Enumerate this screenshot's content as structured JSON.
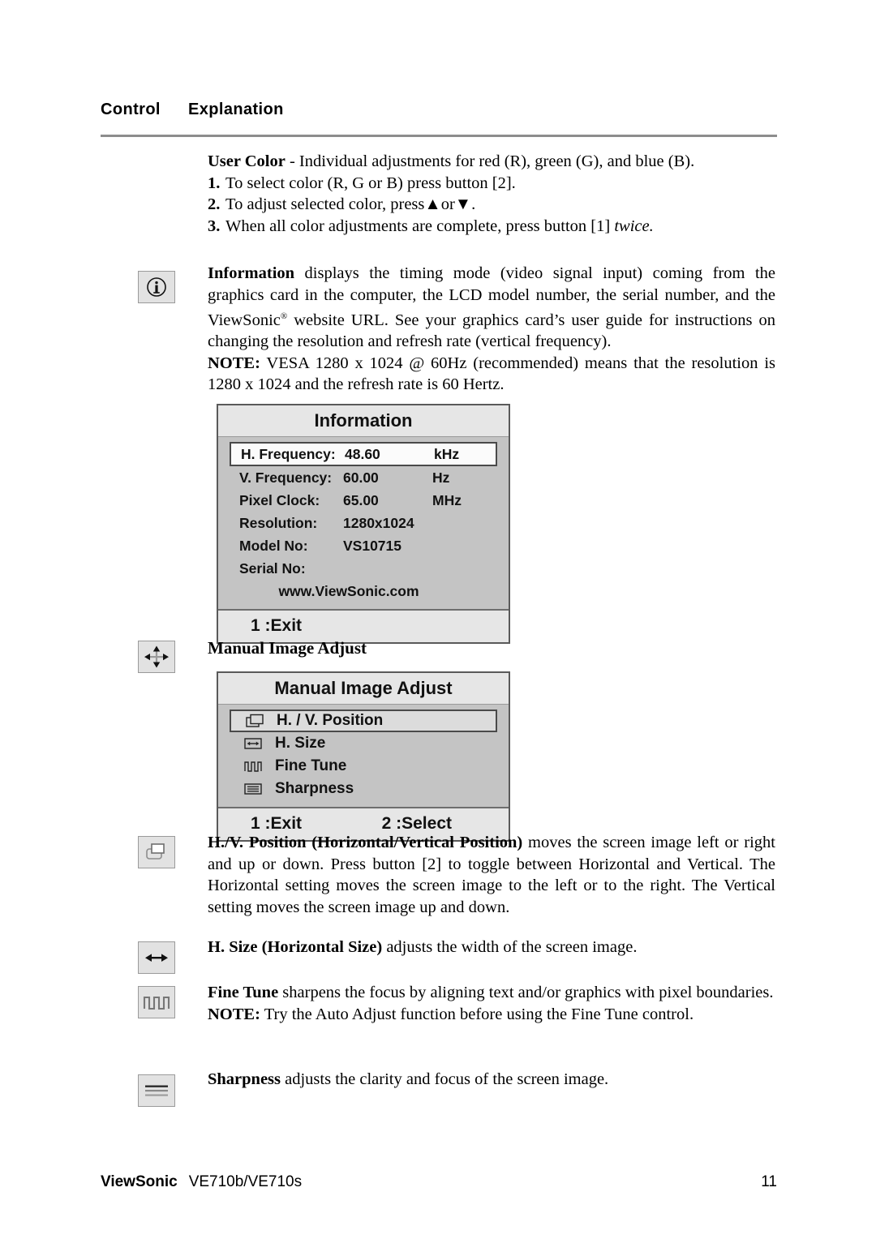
{
  "header": {
    "control_label": "Control",
    "explanation_label": "Explanation"
  },
  "sections": {
    "user_color": {
      "title": "User Color",
      "intro": " - Individual adjustments for red (R), green (G),  and blue (B).",
      "steps": [
        {
          "num": "1.",
          "text": "To select color (R, G or B) press button [2]."
        },
        {
          "num": "2.",
          "text": "To adjust selected color, press",
          "suffix": "or",
          "tail": "."
        },
        {
          "num": "3.",
          "text": "When all color adjustments are complete, press button [1] ",
          "emphasis": "twice."
        }
      ],
      "up_arrow": "▲",
      "down_arrow": "▼"
    },
    "information": {
      "icon": "info-circle-icon",
      "title": "Information",
      "body_1": " displays the timing mode (video signal input) coming from the graphics card in the computer, the LCD model number, the serial number, and the ViewSonic",
      "registered_mark": "®",
      "body_2": " website URL. See your graphics card’s user guide for instructions on changing the resolution and refresh rate (vertical frequency).",
      "note_label": "NOTE:",
      "note_text": " VESA 1280 x 1024 @ 60Hz (recommended) means that the resolution is 1280 x 1024 and the refresh rate is 60 Hertz."
    },
    "manual_image_adjust": {
      "icon": "four-way-arrow-icon",
      "heading": "Manual Image Adjust"
    },
    "hv_position": {
      "icon": "hv-position-icon",
      "title": "H./V. Position (Horizontal/Vertical Position)",
      "text": " moves the screen image left or right and up or down. Press button [2] to toggle between Horizontal and Vertical. The Horizontal setting moves the screen image to the left or to the right. The Vertical setting moves the screen image up and down."
    },
    "h_size": {
      "icon": "horizontal-size-icon",
      "title": "H. Size (Horizontal Size)",
      "text": " adjusts the width of the screen image."
    },
    "fine_tune": {
      "icon": "fine-tune-icon",
      "title": "Fine Tune",
      "text": " sharpens the focus by aligning text and/or graphics with pixel boundaries.",
      "note_label": "NOTE:",
      "note_text": " Try the Auto Adjust function before using the Fine Tune control."
    },
    "sharpness": {
      "icon": "sharpness-icon",
      "title": "Sharpness",
      "text": " adjusts the clarity and focus of the screen image."
    }
  },
  "osd_information": {
    "title": "Information",
    "rows": [
      {
        "label": "H. Frequency:",
        "value": "48.60",
        "unit": "kHz",
        "highlighted": true
      },
      {
        "label": "V. Frequency:",
        "value": "60.00",
        "unit": "Hz",
        "highlighted": false
      },
      {
        "label": "Pixel Clock:",
        "value": "65.00",
        "unit": "MHz",
        "highlighted": false
      },
      {
        "label": "Resolution:",
        "value": "1280x1024",
        "unit": "",
        "highlighted": false
      },
      {
        "label": "Model No:",
        "value": "VS10715",
        "unit": "",
        "highlighted": false
      },
      {
        "label": "Serial No:",
        "value": "",
        "unit": "",
        "highlighted": false
      }
    ],
    "url": "www.ViewSonic.com",
    "footer_exit": "1 :Exit"
  },
  "osd_manual_image_adjust": {
    "title": "Manual Image Adjust",
    "items": [
      {
        "icon": "hv-position-icon",
        "label": "H. / V. Position",
        "highlighted": true
      },
      {
        "icon": "horizontal-size-icon",
        "label": "H. Size",
        "highlighted": false
      },
      {
        "icon": "fine-tune-icon",
        "label": "Fine Tune",
        "highlighted": false
      },
      {
        "icon": "sharpness-icon",
        "label": "Sharpness",
        "highlighted": false
      }
    ],
    "footer_exit": "1 :Exit",
    "footer_select": "2 :Select"
  },
  "footer": {
    "brand": "ViewSonic",
    "model": "VE710b/VE710s",
    "page_number": "11"
  },
  "colors": {
    "osd_body": "#c4c4c4",
    "osd_header": "#e6e6e6",
    "osd_border": "#5a5a5a",
    "rule": "#8d8d8d",
    "icon_box_bg": "#e2e2e2"
  }
}
